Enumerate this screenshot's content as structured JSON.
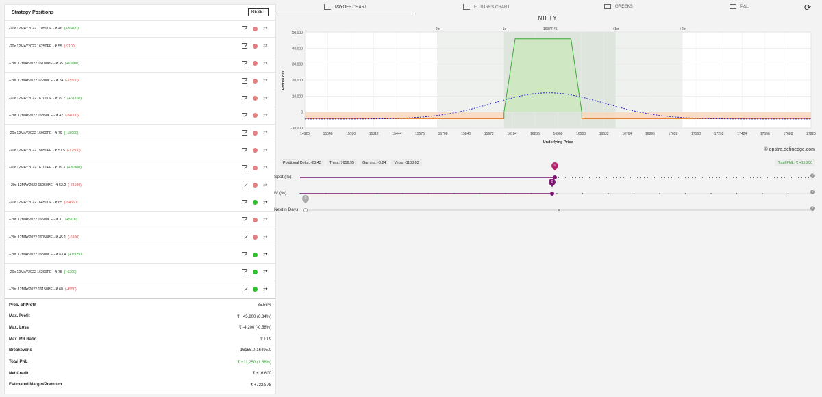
{
  "left_panel": {
    "title": "Strategy Positions",
    "reset_label": "RESET",
    "positions": [
      {
        "text": "-20x 12MAY2022 17050CE - ₹ 46",
        "change": "(+30400)",
        "sign": "pos",
        "active": false
      },
      {
        "text": "-20x 12MAY2022 16250PE - ₹ 55",
        "change": "(-9100)",
        "sign": "neg",
        "active": false
      },
      {
        "text": "+20x 12MAY2022 16100PE - ₹ 35",
        "change": "(+65000)",
        "sign": "pos",
        "active": false
      },
      {
        "text": "+20x 12MAY2022 17200CE - ₹ 24",
        "change": "(-15500)",
        "sign": "neg",
        "active": false
      },
      {
        "text": "-20x 12MAY2022 16700CE - ₹ 79.7",
        "change": "(+61700)",
        "sign": "pos",
        "active": false
      },
      {
        "text": "+20x 12MAY2022 16850CE - ₹ 42",
        "change": "(-34000)",
        "sign": "neg",
        "active": false
      },
      {
        "text": "-20x 12MAY2022 16000PE - ₹ 79",
        "change": "(+18900)",
        "sign": "pos",
        "active": false
      },
      {
        "text": "-20x 12MAY2022 15850PE - ₹ 51.5",
        "change": "(-12500)",
        "sign": "neg",
        "active": false
      },
      {
        "text": "-20x 12MAY2022 16100PE - ₹ 79.3",
        "change": "(+30300)",
        "sign": "pos",
        "active": false
      },
      {
        "text": "+20x 12MAY2022 15950PE - ₹ 52.2",
        "change": "(-23100)",
        "sign": "neg",
        "active": false
      },
      {
        "text": "-20x 12MAY2022 16450CE - ₹ 65",
        "change": "(-84650)",
        "sign": "neg",
        "active": true
      },
      {
        "text": "+20x 12MAY2022 16600CE - ₹ 31",
        "change": "(+5100)",
        "sign": "pos",
        "active": false
      },
      {
        "text": "+20x 12MAY2022 16050PE - ₹ 45.1",
        "change": "(-6100)",
        "sign": "neg",
        "active": false
      },
      {
        "text": "+20x 12MAY2022 16500CE - ₹ 63.4",
        "change": "(+15050)",
        "sign": "pos",
        "active": true
      },
      {
        "text": "-20x 12MAY2022 16200PE - ₹ 75",
        "change": "(+6200)",
        "sign": "pos",
        "active": true
      },
      {
        "text": "+20x 12MAY2022 16150PE - ₹ 60",
        "change": "(-4550)",
        "sign": "neg",
        "active": true
      }
    ],
    "summary": [
      {
        "label": "Prob. of Profit",
        "value": "35.56%",
        "color": ""
      },
      {
        "label": "Max. Profit",
        "value": "₹ +45,800 (6.34%)",
        "color": ""
      },
      {
        "label": "Max. Loss",
        "value": "₹ -4,200 (-0.58%)",
        "color": ""
      },
      {
        "label": "Max. RR Ratio",
        "value": "1:10.9",
        "color": ""
      },
      {
        "label": "Breakevens",
        "value": "16155.0-16495.0",
        "color": ""
      },
      {
        "label": "Total PNL",
        "value": "₹ +11,250 (1.56%)",
        "color": "green"
      },
      {
        "label": "Net Credit",
        "value": "₹ +16,600",
        "color": ""
      },
      {
        "label": "Estimated Margin/Premium",
        "value": "₹ +722,878",
        "color": ""
      }
    ]
  },
  "tabs": [
    {
      "label": "PAYOFF CHART",
      "icon": "area-chart-icon",
      "active": true
    },
    {
      "label": "FUTURES CHART",
      "icon": "line-chart-icon",
      "active": false
    },
    {
      "label": "GREEKS",
      "icon": "table-icon",
      "active": false
    },
    {
      "label": "P&L",
      "icon": "grid-icon",
      "active": false
    }
  ],
  "chart_title": "NIFTY",
  "credit_text": "© opstra.definedge.com",
  "stats": {
    "delta": "Positional Delta: -28.43",
    "theta": "Theta: 7656.95",
    "gamma": "Gamma: -0.24",
    "vega": "Vega: -1103.03",
    "total_pnl": "Total PNL: ₹ +11,250"
  },
  "sliders": [
    {
      "label": "Spot (%):",
      "value": "0",
      "handle_color": "#b3246b"
    },
    {
      "label": "IV (%):",
      "value": "0",
      "handle_color": "#7b1570"
    },
    {
      "label": "Next n Days:",
      "value": "0",
      "handle_color": "#aaaaaa"
    }
  ],
  "chart_data": {
    "type": "line",
    "title": "NIFTY",
    "xlabel": "Underlying Price",
    "ylabel": "Profit/Loss",
    "xlim": [
      14926,
      17920
    ],
    "ylim": [
      -10000,
      50000
    ],
    "x_ticks": [
      "14926",
      "15048",
      "15180",
      "15312",
      "15444",
      "15576",
      "15708",
      "15840",
      "15972",
      "16104",
      "16236",
      "16368",
      "16500",
      "16632",
      "16764",
      "16896",
      "17028",
      "17160",
      "17292",
      "17424",
      "17556",
      "17688",
      "17820"
    ],
    "y_ticks": [
      "50,000",
      "40,000",
      "30,000",
      "20,000",
      "10,000",
      "0",
      "-10,000"
    ],
    "top_ticks": [
      "-2σ",
      "-1σ",
      "16377.45",
      "+1σ",
      "+2σ"
    ],
    "series": [
      {
        "name": "Expiry",
        "color": "#e8833a",
        "x": [
          14926,
          16104,
          16170,
          16236,
          16368,
          16500,
          16564,
          17920
        ],
        "y": [
          -4200,
          -4200,
          45800,
          45800,
          45800,
          45800,
          -4200,
          -4200
        ]
      },
      {
        "name": "Target",
        "color": "#2222cc",
        "style": "dashed",
        "x": [
          14926,
          15444,
          15840,
          16104,
          16368,
          16632,
          16896,
          17160,
          17424,
          17920
        ],
        "y": [
          -4200,
          -3500,
          500,
          8500,
          12000,
          8500,
          500,
          -3500,
          -4200,
          -4200
        ]
      }
    ],
    "sd_bands": {
      "center": 16377.45,
      "minus2": 15708,
      "minus1": 16104,
      "plus1": 16764,
      "plus2": 17160
    },
    "grid": true
  }
}
